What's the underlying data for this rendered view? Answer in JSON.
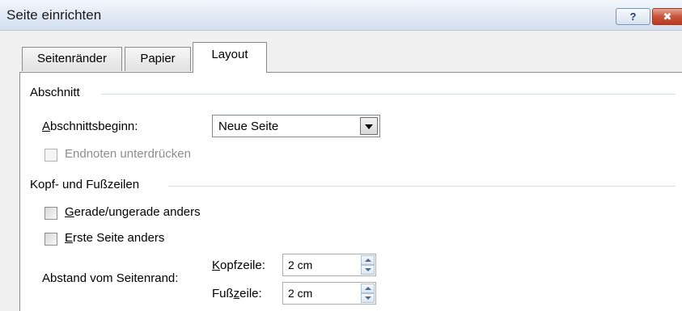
{
  "window": {
    "title": "Seite einrichten",
    "help_label": "?",
    "close_label": "✖"
  },
  "tabs": [
    {
      "label": "Seitenränder"
    },
    {
      "label": "Papier"
    },
    {
      "label": "Layout",
      "active": true
    }
  ],
  "section": {
    "heading": "Abschnitt",
    "start_label_mnemonic": "A",
    "start_label_rest": "bschnittsbeginn:",
    "start_value": "Neue Seite",
    "endnotes_label": "Endnoten unterdrücken",
    "endnotes_checked": false,
    "endnotes_enabled": false
  },
  "headers_footers": {
    "heading": "Kopf- und Fußzeilen",
    "odd_even_mnemonic": "G",
    "odd_even_rest": "erade/ungerade anders",
    "odd_even_checked": false,
    "first_page_mnemonic": "E",
    "first_page_rest": "rste Seite anders",
    "first_page_checked": false,
    "distance_label": "Abstand vom Seitenrand:",
    "header_label_mnemonic": "K",
    "header_label_rest": "opfzeile:",
    "header_value": "2 cm",
    "footer_label_pre": "Fuß",
    "footer_label_mnemonic": "z",
    "footer_label_rest": "eile:",
    "footer_value": "2 cm"
  }
}
